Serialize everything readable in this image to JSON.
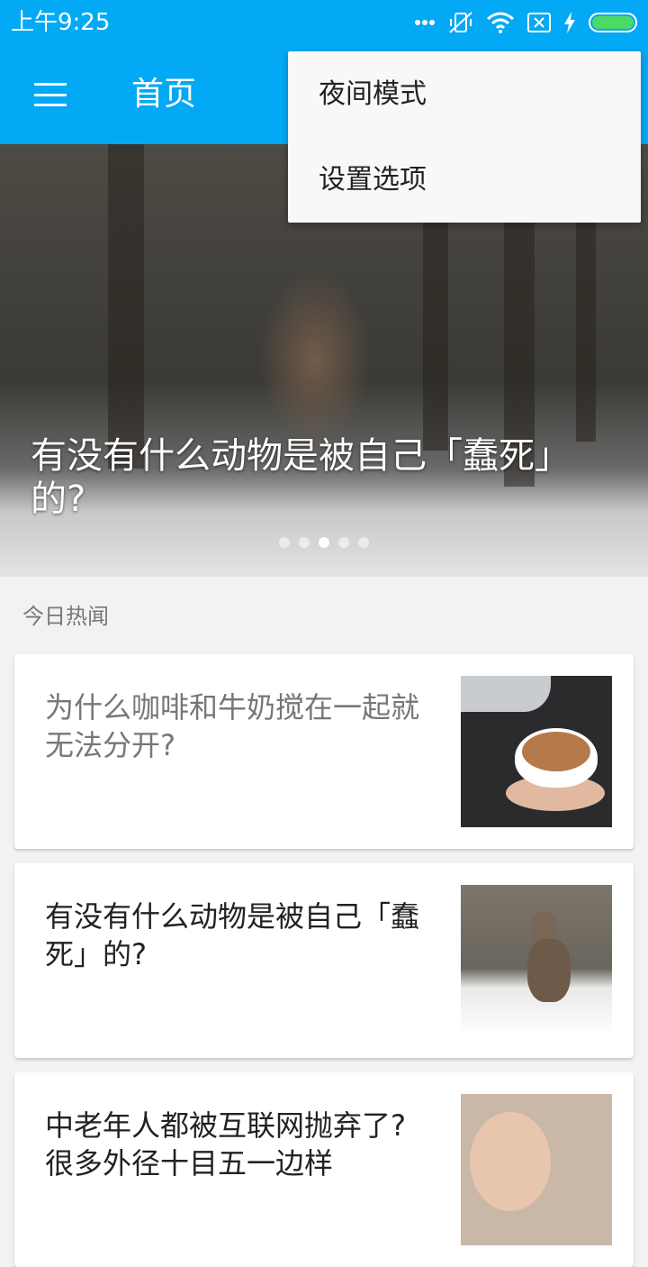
{
  "status_bar": {
    "time": "上午9:25",
    "icons": [
      "more-dots-icon",
      "vibrate-off-icon",
      "wifi-icon",
      "sim-none-icon",
      "charging-icon",
      "battery-icon"
    ],
    "battery_level": 1.0,
    "battery_color": "#4CD964"
  },
  "toolbar": {
    "title": "首页",
    "menu_icon": "hamburger-icon",
    "background": "#03A9F4"
  },
  "overflow_menu": {
    "items": [
      {
        "label": "夜间模式"
      },
      {
        "label": "设置选项"
      }
    ]
  },
  "banner": {
    "caption": "有没有什么动物是被自己「蠢死」的?",
    "image": "deer-in-snow-photo",
    "page_count": 5,
    "active_page": 3
  },
  "section": {
    "label": "今日热闻"
  },
  "stories": [
    {
      "title": "为什么咖啡和牛奶搅在一起就无法分开?",
      "read": true,
      "thumbnail": "latte-art-photo"
    },
    {
      "title": "有没有什么动物是被自己「蠢死」的?",
      "read": false,
      "thumbnail": "deer-photo"
    },
    {
      "title": "中老年人都被互联网抛弃了?很多外径十目五一边样",
      "read": false,
      "thumbnail": "elderly-couple-photo"
    }
  ]
}
